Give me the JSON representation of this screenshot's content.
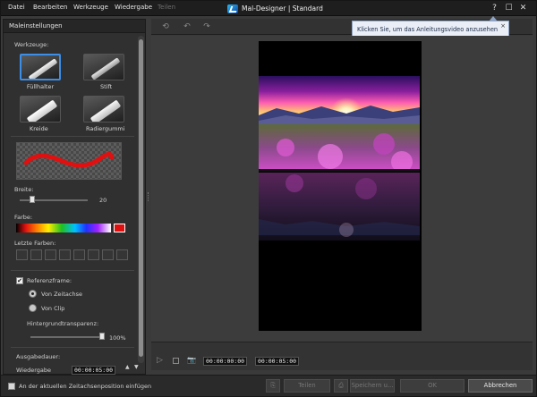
{
  "menu": {
    "datei": "Datei",
    "bearbeiten": "Bearbeiten",
    "werkzeuge": "Werkzeuge",
    "wiedergabe": "Wiedergabe",
    "teilen": "Teilen"
  },
  "window": {
    "title": "Mal-Designer | Standard",
    "help": "?",
    "maximize": "☐",
    "close": "✕"
  },
  "tooltip": {
    "text": "Klicken Sie, um das Anleitungsvideo anzusehen",
    "close": "×"
  },
  "panel": {
    "title": "Maleinstellungen",
    "tools_label": "Werkzeuge:",
    "tools": [
      "Füllhalter",
      "Stift",
      "Kreide",
      "Radiergummi"
    ],
    "selected_tool": "Füllhalter",
    "width_label": "Breite:",
    "width_value": "20",
    "width_fraction": 0.18,
    "color_label": "Farbe:",
    "selected_color": "#e01010",
    "recent_colors_label": "Letzte Farben:",
    "reference_label": "Referenzframe:",
    "reference_checked": true,
    "radio_timeline": "Von Zeitachse",
    "radio_clip": "Von Clip",
    "radio_selected": "Von Zeitachse",
    "bg_transparency_label": "Hintergrundtransparenz:",
    "bg_transparency_value": "100%",
    "bg_transparency_fraction": 1.0,
    "output_duration_label": "Ausgabedauer:",
    "playback_label": "Wiedergabe",
    "playback_time": "00:00:05:00"
  },
  "playbar": {
    "current_time": "00:00:00:00",
    "duration": "00:00:05:00"
  },
  "bottom": {
    "insert_checkbox_label": "An der aktuellen Zeitachsenposition einfügen",
    "share_label": "Teilen",
    "save_label": "Speichern u...",
    "ok_label": "OK",
    "cancel_label": "Abbrechen"
  },
  "colors": {
    "accent": "#3d8ee6",
    "brush_stroke": "#e01010"
  }
}
